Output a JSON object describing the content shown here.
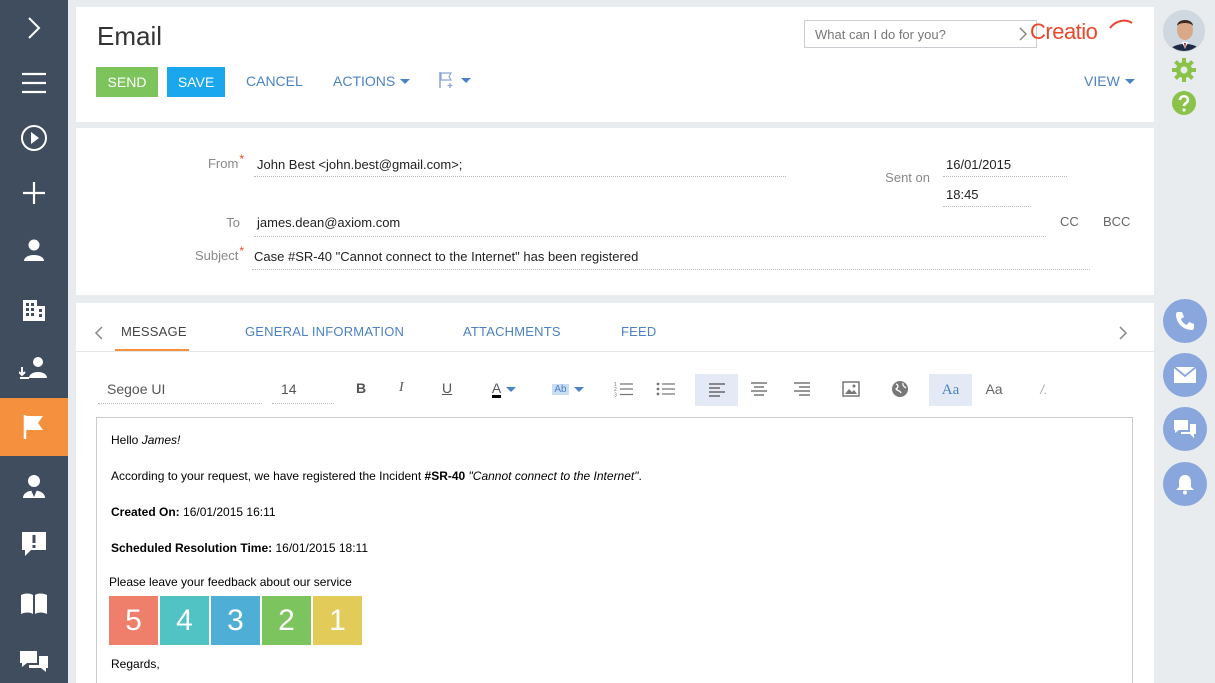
{
  "app": {
    "brand": "Creatio"
  },
  "page": {
    "title": "Email"
  },
  "search": {
    "placeholder": "What can I do for you?"
  },
  "toolbar": {
    "send_label": "SEND",
    "save_label": "SAVE",
    "cancel_label": "CANCEL",
    "actions_label": "ACTIONS",
    "view_label": "VIEW"
  },
  "colors": {
    "send": "#7dc45c",
    "save": "#1aa7ee",
    "accent": "#f5913e",
    "brand": "#e8482b",
    "link": "#4c82c3",
    "sidebar": "#3f4d5f"
  },
  "fields": {
    "from_label": "From",
    "from_value": "John Best <john.best@gmail.com>;",
    "sent_on_label": "Sent on",
    "sent_date": "16/01/2015",
    "sent_time": "18:45",
    "to_label": "To",
    "to_value": "james.dean@axiom.com",
    "cc_label": "CC",
    "bcc_label": "BCC",
    "subject_label": "Subject",
    "subject_value": "Case #SR-40 \"Cannot connect to the Internet\" has been registered"
  },
  "tabs": [
    {
      "label": "MESSAGE",
      "active": true
    },
    {
      "label": "GENERAL INFORMATION",
      "active": false
    },
    {
      "label": "ATTACHMENTS",
      "active": false
    },
    {
      "label": "FEED",
      "active": false
    }
  ],
  "editor_toolbar": {
    "font_family": "Segoe UI",
    "font_size": "14",
    "bold": "B",
    "italic": "I",
    "underline": "U",
    "text_color": "A",
    "highlight": "Ab",
    "styles_on": "Aa",
    "styles_off": "Aa",
    "clear": "/."
  },
  "message": {
    "greeting": "Hello ",
    "greeting_name": "James!",
    "line1_prefix": "According to your request, we have registered the Incident ",
    "line1_case": "#SR-40",
    "line1_title": " \"Cannot connect to the Internet\"",
    "line1_end": ".",
    "created_label": "Created On:",
    "created_value": " 16/01/2015 16:11",
    "resolution_label": "Scheduled Resolution Time:",
    "resolution_value": " 16/01/2015 18:11",
    "feedback_prompt": "Please leave your feedback about our service",
    "regards": "Regards,",
    "ratings": [
      {
        "value": "5",
        "color": "#ef7f6a"
      },
      {
        "value": "4",
        "color": "#52c3c4"
      },
      {
        "value": "3",
        "color": "#4faed6"
      },
      {
        "value": "2",
        "color": "#7cc45e"
      },
      {
        "value": "1",
        "color": "#e3cb5a"
      }
    ]
  },
  "sidebar_icons": [
    "chevron-right-icon",
    "menu-icon",
    "play-icon",
    "plus-icon",
    "contact-icon",
    "accounts-icon",
    "leads-icon",
    "flag-icon",
    "agent-icon",
    "alert-icon",
    "book-icon",
    "chat-icon"
  ],
  "rail_icons": [
    "avatar",
    "gear-icon",
    "help-icon",
    "phone-icon",
    "email-icon",
    "feed-icon",
    "bell-icon"
  ]
}
